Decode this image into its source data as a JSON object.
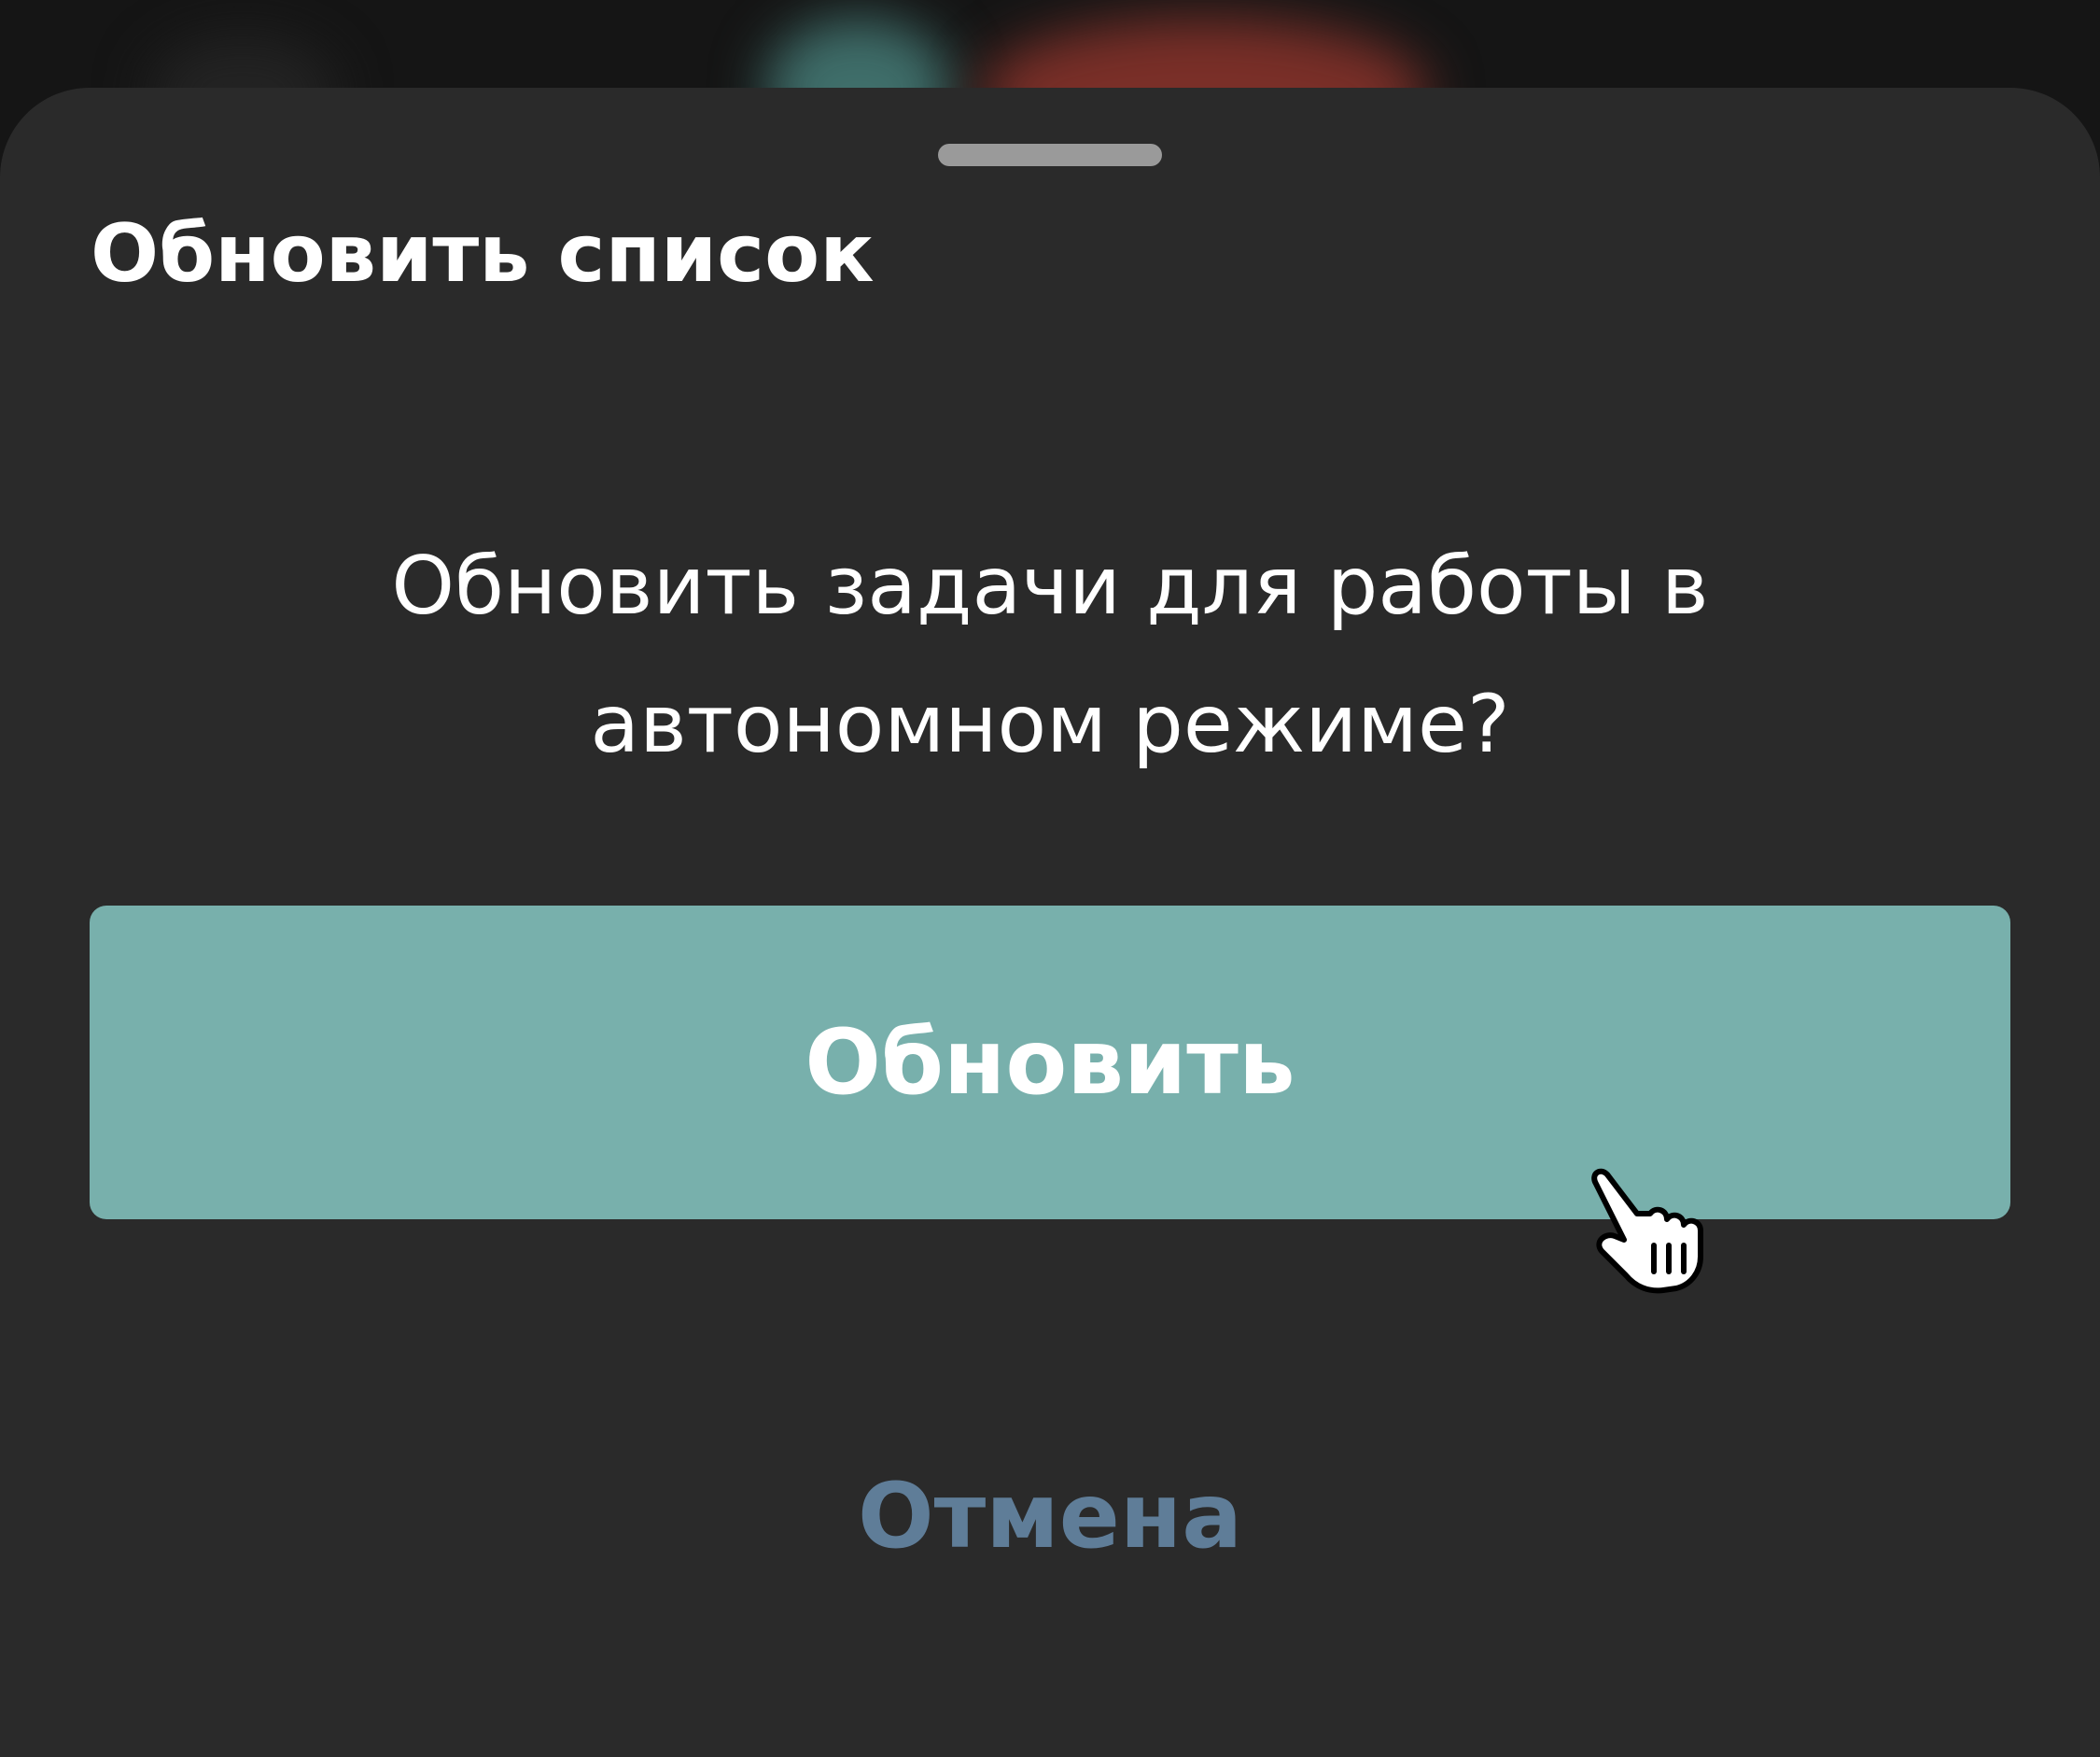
{
  "dialog": {
    "title": "Обновить список",
    "message_line1": "Обновить задачи для работы в",
    "message_line2": "автономном режиме?",
    "confirm_label": "Обновить",
    "cancel_label": "Отмена"
  },
  "colors": {
    "sheet_background": "#2a2a2a",
    "primary_button": "#78b0ac",
    "cancel_text": "#5f7d98",
    "text": "#ffffff"
  },
  "icons": {
    "cursor": "hand-pointer-icon",
    "drag_handle": "drag-handle"
  }
}
